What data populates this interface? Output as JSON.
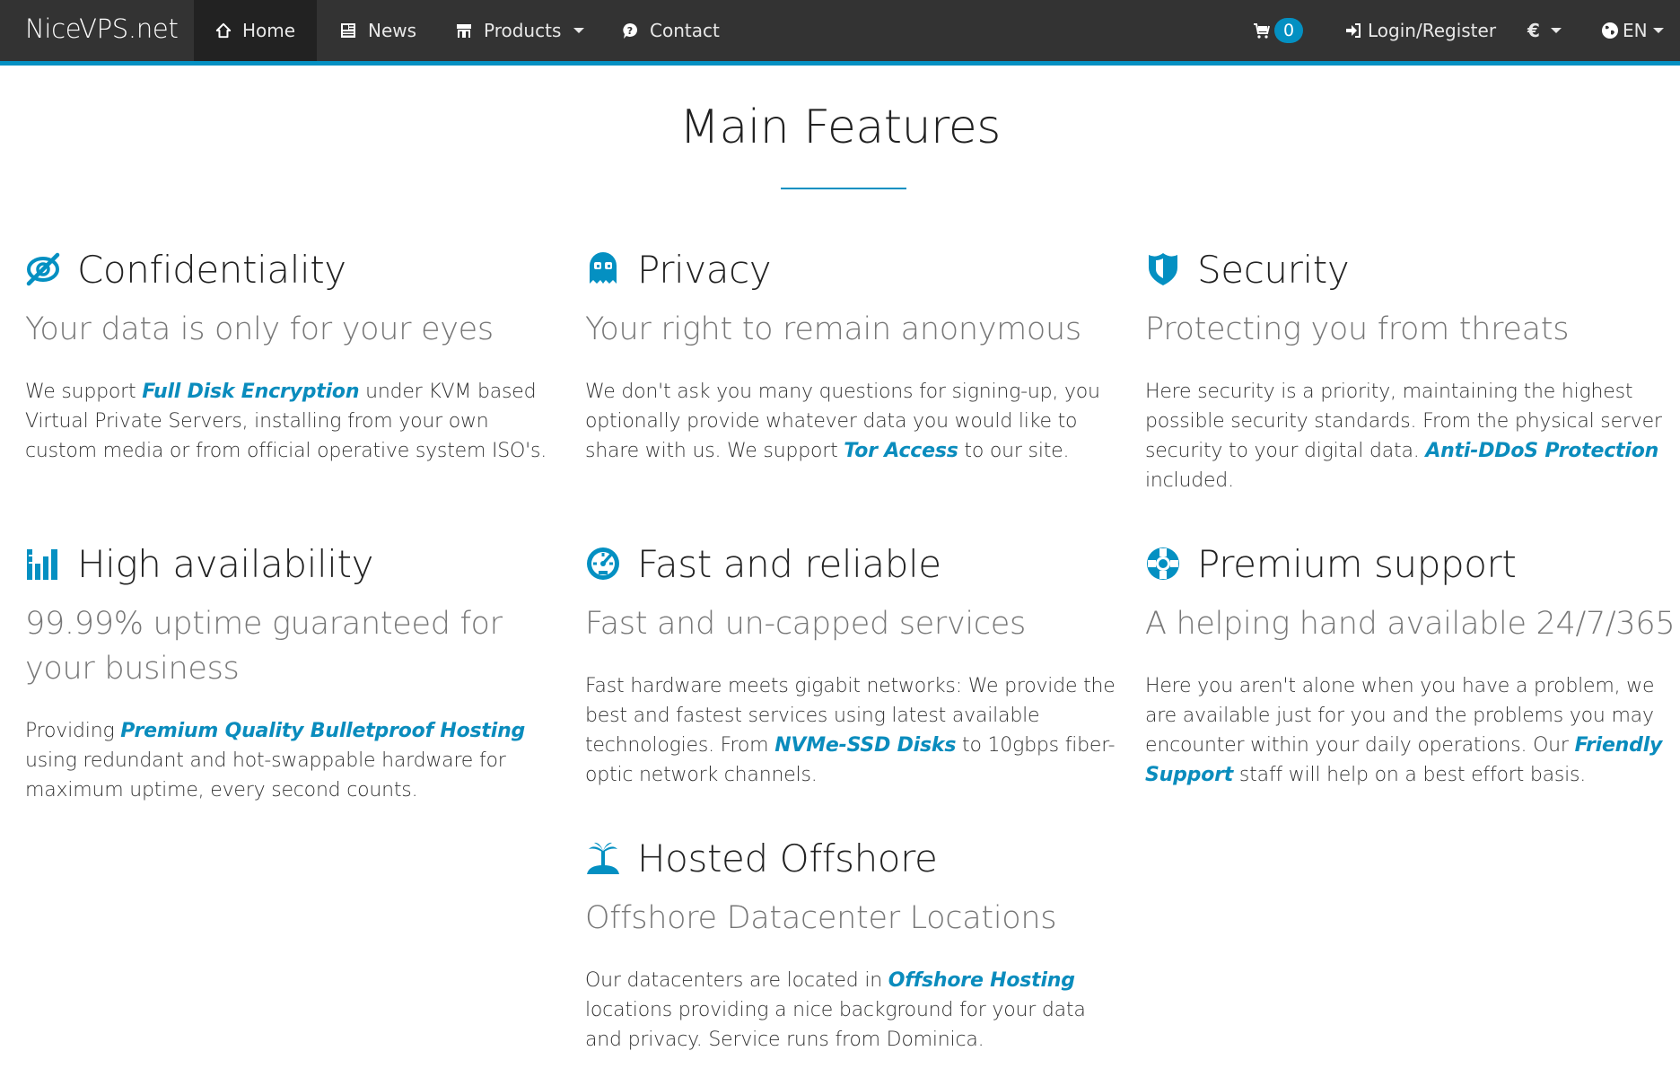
{
  "nav": {
    "brand": "NiceVPS.net",
    "items": [
      {
        "label": "Home",
        "icon": "home-icon",
        "active": true
      },
      {
        "label": "News",
        "icon": "newspaper-icon",
        "active": false
      },
      {
        "label": "Products",
        "icon": "store-icon",
        "active": false,
        "dropdown": true
      },
      {
        "label": "Contact",
        "icon": "question-bubble-icon",
        "active": false
      }
    ],
    "cart_count": "0",
    "login_label": "Login/Register",
    "currency": "€",
    "language": "EN"
  },
  "colors": {
    "accent": "#0490c2",
    "navbar_bg": "#333333",
    "nav_active_bg": "#222222",
    "link": "#0a8cbd"
  },
  "main": {
    "title": "Main Features",
    "features": [
      {
        "icon": "eye-slash-icon",
        "title": "Confidentiality",
        "subtitle": "Your data is only for your eyes",
        "text_before": "We support ",
        "link": "Full Disk Encryption",
        "text_after": " under KVM based Virtual Private Servers, installing from your own custom media or from official operative system ISO's."
      },
      {
        "icon": "ghost-icon",
        "title": "Privacy",
        "subtitle": "Your right to remain anonymous",
        "text_before": "We don't ask you many questions for signing-up, you optionally provide whatever data you would like to share with us. We support ",
        "link": "Tor Access",
        "text_after": " to our site."
      },
      {
        "icon": "shield-icon",
        "title": "Security",
        "subtitle": "Protecting you from threats",
        "text_before": "Here security is a priority, maintaining the highest possible security standards. From the physical server security to your digital data. ",
        "link": "Anti-DDoS Protection",
        "text_after": " included."
      },
      {
        "icon": "signal-bars-icon",
        "title": "High availability",
        "subtitle": "99.99% uptime guaranteed for your business",
        "text_before": "Providing ",
        "link": "Premium Quality Bulletproof Hosting",
        "text_after": " using redundant and hot-swappable hardware for maximum uptime, every second counts."
      },
      {
        "icon": "speedometer-icon",
        "title": "Fast and reliable",
        "subtitle": "Fast and un-capped services",
        "text_before": "Fast hardware meets gigabit networks: We provide the best and fastest services using latest available technologies. From ",
        "link": "NVMe-SSD Disks",
        "text_after": " to 10gbps fiber-optic network channels."
      },
      {
        "icon": "lifebuoy-icon",
        "title": "Premium support",
        "subtitle": "A helping hand available 24/7/365",
        "text_before": "Here you aren't alone when you have a problem, we are available just for you and the problems you may encounter within your daily operations. Our ",
        "link": "Friendly Support",
        "text_after": " staff will help on a best effort basis."
      },
      {
        "icon": "palm-island-icon",
        "title": "Hosted Offshore",
        "subtitle": "Offshore Datacenter Locations",
        "text_before": "Our datacenters are located in ",
        "link": "Offshore Hosting",
        "text_after": " locations providing a nice background for your data and privacy. Service runs from Dominica."
      }
    ]
  }
}
